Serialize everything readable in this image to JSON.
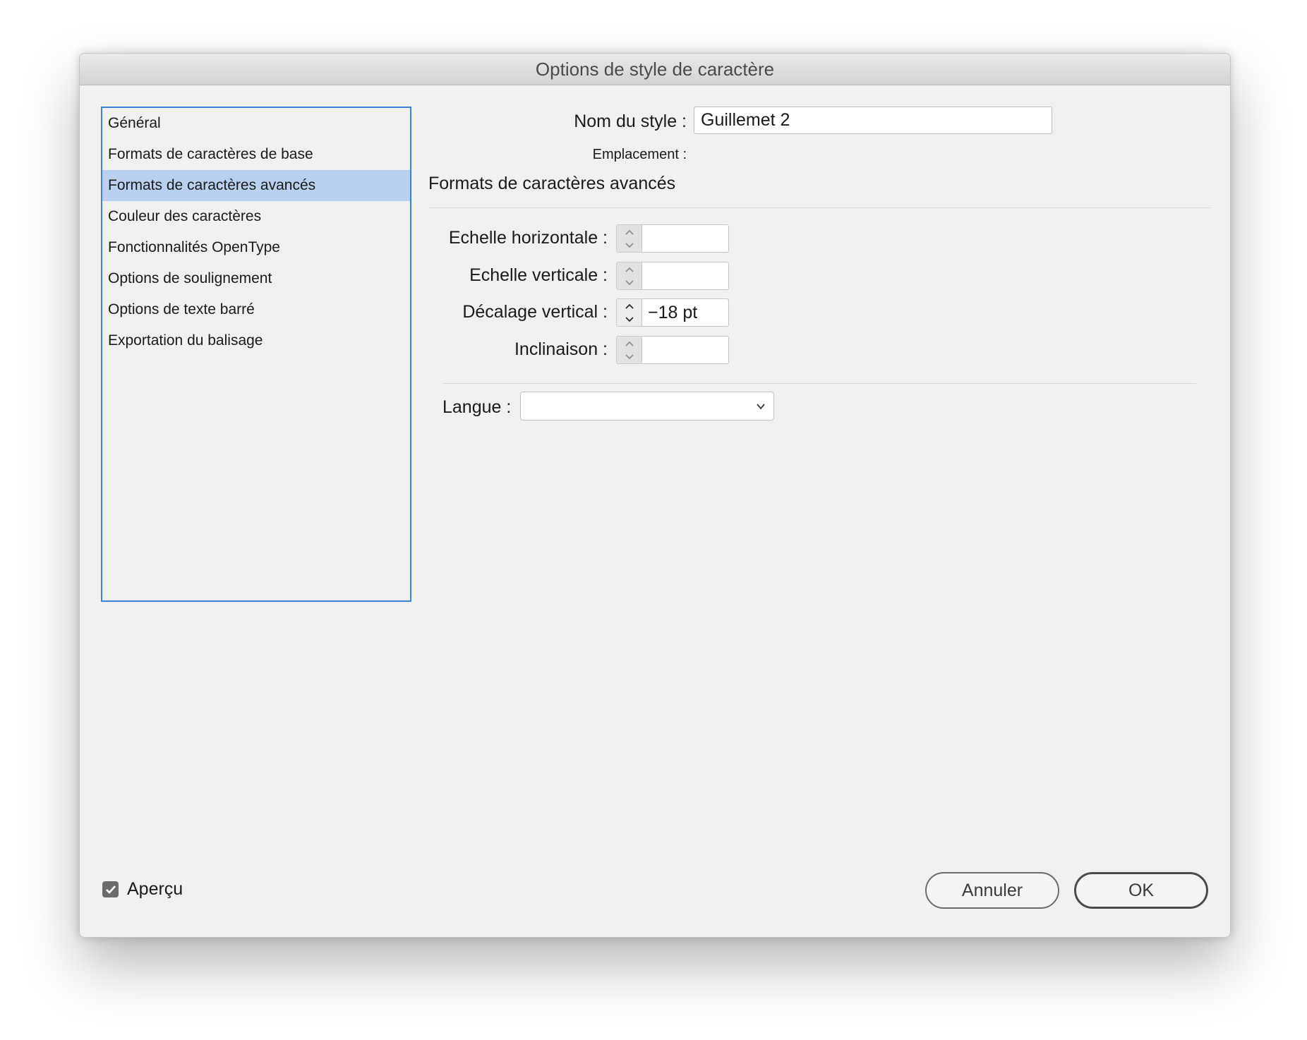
{
  "window": {
    "title": "Options de style de caractère"
  },
  "sidebar": {
    "items": [
      {
        "label": "Général",
        "selected": false
      },
      {
        "label": "Formats de caractères de base",
        "selected": false
      },
      {
        "label": "Formats de caractères avancés",
        "selected": true
      },
      {
        "label": "Couleur des caractères",
        "selected": false
      },
      {
        "label": "Fonctionnalités OpenType",
        "selected": false
      },
      {
        "label": "Options de soulignement",
        "selected": false
      },
      {
        "label": "Options de texte barré",
        "selected": false
      },
      {
        "label": "Exportation du balisage",
        "selected": false
      }
    ]
  },
  "form": {
    "style_name_label": "Nom du style :",
    "style_name_value": "Guillemet 2",
    "location_label": "Emplacement :",
    "section_title": "Formats de caractères avancés",
    "horizontal_scale": {
      "label": "Echelle horizontale :",
      "value": ""
    },
    "vertical_scale": {
      "label": "Echelle verticale :",
      "value": ""
    },
    "baseline_shift": {
      "label": "Décalage vertical :",
      "value": "−18 pt"
    },
    "skew": {
      "label": "Inclinaison :",
      "value": ""
    },
    "language": {
      "label": "Langue :",
      "value": ""
    }
  },
  "footer": {
    "preview_label": "Aperçu",
    "preview_checked": true,
    "cancel_label": "Annuler",
    "ok_label": "OK"
  },
  "colors": {
    "accent_focus": "#3b82d8",
    "selection": "#b9d1ee",
    "dialog_bg": "#f0f0f0"
  }
}
